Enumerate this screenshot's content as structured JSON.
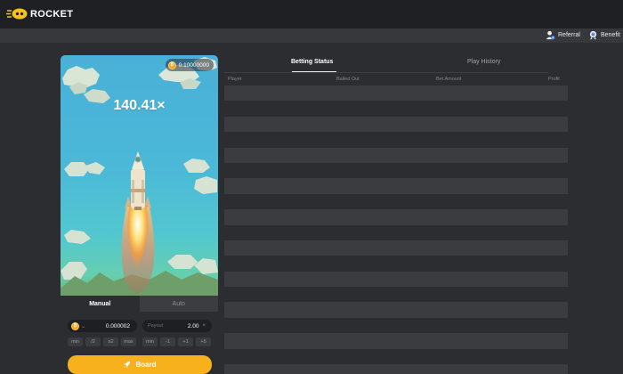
{
  "header": {
    "logo_text": "ROCKET",
    "links": [
      {
        "label": "Referral",
        "icon": "referral-icon"
      },
      {
        "label": "Benefit",
        "icon": "benefit-icon"
      }
    ]
  },
  "game": {
    "balance": "0.10000000",
    "currency_icon": "coin-icon",
    "multiplier": "140.41×"
  },
  "bet_panel": {
    "tabs": [
      "Manual",
      "Auto"
    ],
    "active_tab": "Manual",
    "amount": "0.000002",
    "payout_label": "Payout",
    "payout": "2.00",
    "clear_symbol": "×",
    "amount_buttons": [
      "min",
      "/2",
      "x2",
      "max"
    ],
    "payout_buttons": [
      "min",
      "-1",
      "+1",
      "+5"
    ],
    "board_label": "Board"
  },
  "status": {
    "tabs": [
      "Betting Status",
      "Play History"
    ],
    "active_tab": "Betting Status",
    "columns": [
      "Player",
      "Bailed Out",
      "Bet Amount",
      "Profit"
    ],
    "rows": []
  },
  "colors": {
    "accent": "#f6b11c",
    "background": "#2b2d30",
    "topbar": "#1f2023"
  }
}
